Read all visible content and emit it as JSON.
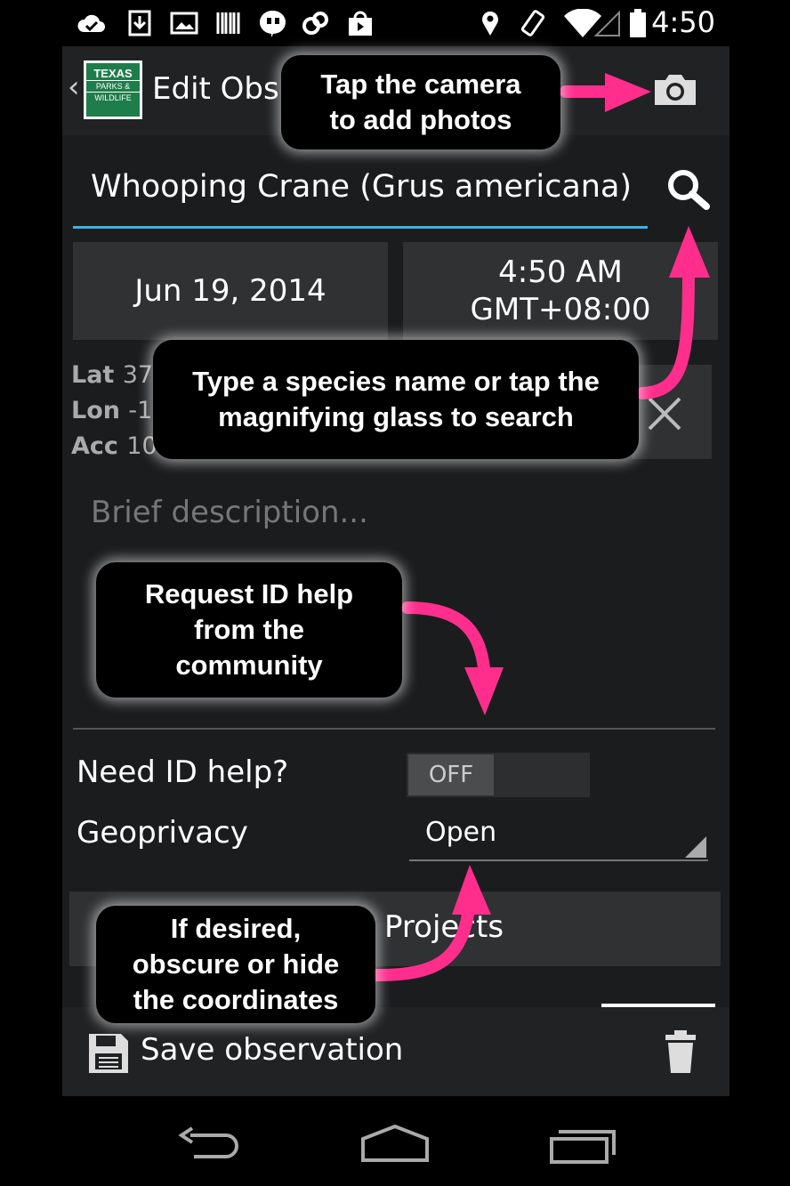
{
  "status_bar": {
    "time": "4:50",
    "icons": [
      "cloud-check-icon",
      "download-icon",
      "image-icon",
      "barcode-icon",
      "hangouts-icon",
      "link-icon",
      "shopping-bag-icon",
      "location-icon",
      "rotation-icon",
      "wifi-icon",
      "signal-icon",
      "battery-icon"
    ]
  },
  "action_bar": {
    "logo_line1": "TEXAS",
    "logo_line2": "PARKS &",
    "logo_line3": "WILDLIFE",
    "title": "Edit Obs",
    "back_glyph": "‹"
  },
  "species_input": {
    "value": "Whooping Crane (Grus americana)"
  },
  "date_button": {
    "label": "Jun 19, 2014"
  },
  "time_button": {
    "line1": "4:50 AM",
    "line2": "GMT+08:00"
  },
  "location": {
    "lat_label": "Lat",
    "lat_value": "37",
    "lon_label": "Lon",
    "lon_value": "-1",
    "acc_label": "Acc",
    "acc_value": "10"
  },
  "description": {
    "placeholder": "Brief description..."
  },
  "id_help": {
    "label": "Need ID help?",
    "toggle": "OFF"
  },
  "geoprivacy": {
    "label": "Geoprivacy",
    "value": "Open"
  },
  "projects": {
    "label": "Projects"
  },
  "bottom_bar": {
    "save_label": "Save observation"
  },
  "callouts": {
    "camera": "Tap the camera to add photos",
    "species": "Type a species name  or tap the magnifying glass to search",
    "id_help": "Request ID help from the community",
    "geoprivacy": "If desired, obscure or hide the coordinates"
  },
  "colors": {
    "arrow": "#ff2e8c",
    "accent": "#33b5e5",
    "panel": "#2f3133",
    "background": "#1b1c1e"
  }
}
